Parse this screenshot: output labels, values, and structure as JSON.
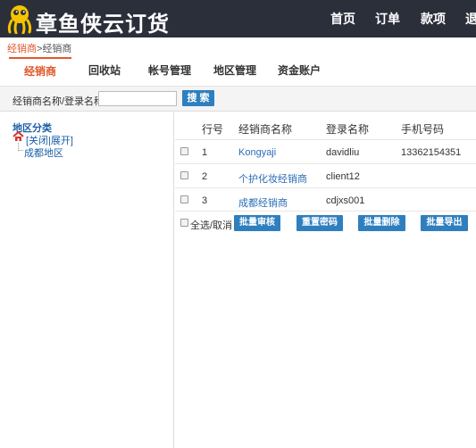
{
  "header": {
    "brand": "章鱼侠云订货",
    "nav": [
      "首页",
      "订单",
      "款项",
      "退"
    ]
  },
  "breadcrumb": {
    "link": "经销商",
    "separator": ">",
    "current": "经销商"
  },
  "tabs": [
    "经销商",
    "回收站",
    "帐号管理",
    "地区管理",
    "资金账户"
  ],
  "search": {
    "label": "经销商名称/登录名称：",
    "value": "",
    "placeholder": "",
    "button": "搜 索"
  },
  "tree": {
    "title": "地区分类",
    "toggle": "[关闭|展开]",
    "nodes": [
      "成都地区"
    ]
  },
  "table": {
    "headers": [
      "行号",
      "经销商名称",
      "登录名称",
      "手机号码"
    ],
    "rows": [
      {
        "no": "1",
        "name": "Kongyaji",
        "login": "davidliu",
        "phone": "13362154351"
      },
      {
        "no": "2",
        "name": "个护化妆经销商",
        "login": "client12",
        "phone": ""
      },
      {
        "no": "3",
        "name": "成都经销商",
        "login": "cdjxs001",
        "phone": ""
      }
    ]
  },
  "actions": {
    "select_all": "全选/取消",
    "buttons": [
      "批量审核",
      "重置密码",
      "批量删除",
      "批量导出"
    ]
  },
  "colors": {
    "header_bg": "#2b2f3a",
    "accent": "#e1572b",
    "button": "#2f7fbf",
    "link": "#2a6db5"
  }
}
